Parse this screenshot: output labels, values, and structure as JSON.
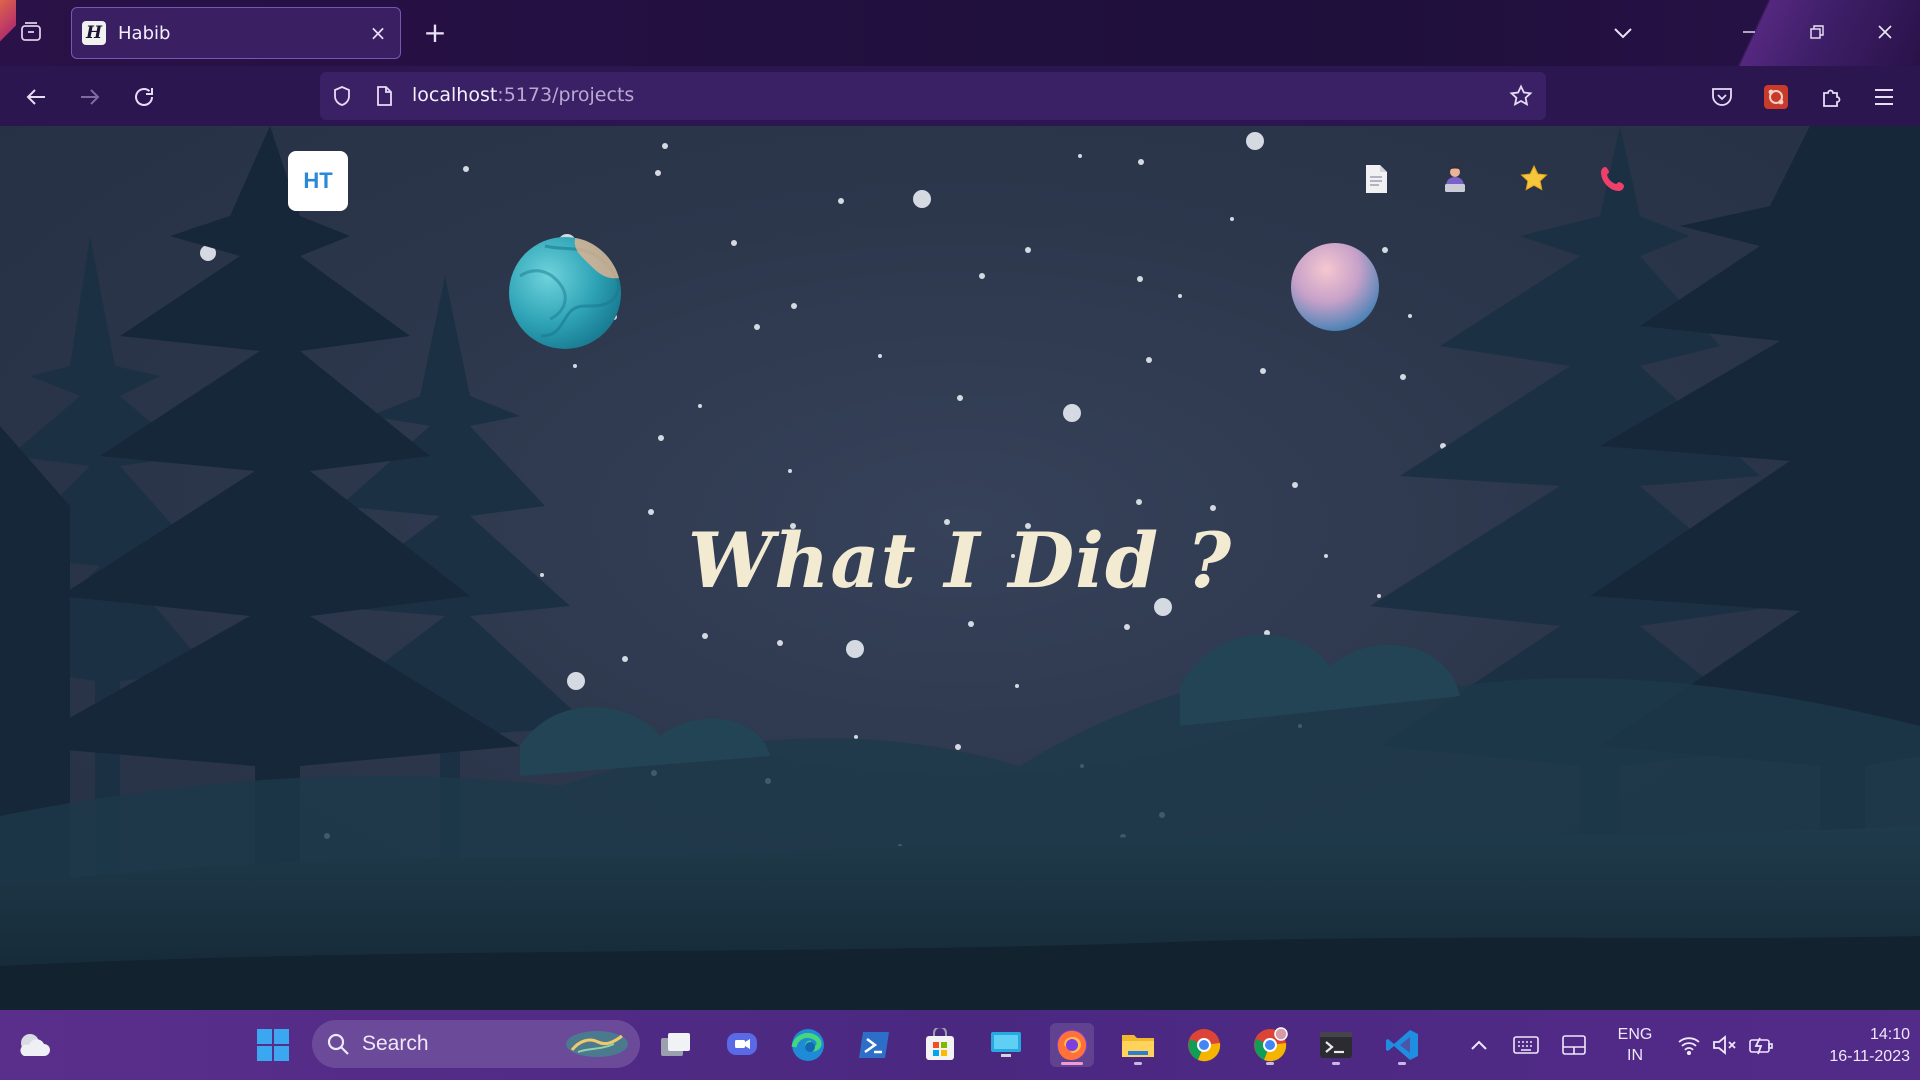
{
  "browser": {
    "tab": {
      "favicon": "H",
      "title": "Habib",
      "close": "×"
    },
    "new_tab": "+",
    "url": {
      "host": "localhost",
      "rest": ":5173/projects"
    }
  },
  "page": {
    "logo": "HT",
    "nav_icons": [
      "document-icon",
      "person-laptop-icon",
      "star-icon",
      "phone-icon"
    ],
    "headline": "What I Did ?",
    "colors": {
      "headline": "#f3ead2",
      "sky": "#2d374c",
      "tree": "#17293a",
      "logo_text": "#2a88d8"
    }
  },
  "taskbar": {
    "search_label": "Search",
    "apps": [
      "start",
      "search",
      "task-view",
      "meet",
      "edge",
      "powershell",
      "store",
      "remote-desktop",
      "firefox",
      "file-explorer",
      "chrome",
      "chrome-profile",
      "terminal",
      "vscode"
    ],
    "lang_line1": "ENG",
    "lang_line2": "IN",
    "time": "14:10",
    "date": "16-11-2023"
  }
}
